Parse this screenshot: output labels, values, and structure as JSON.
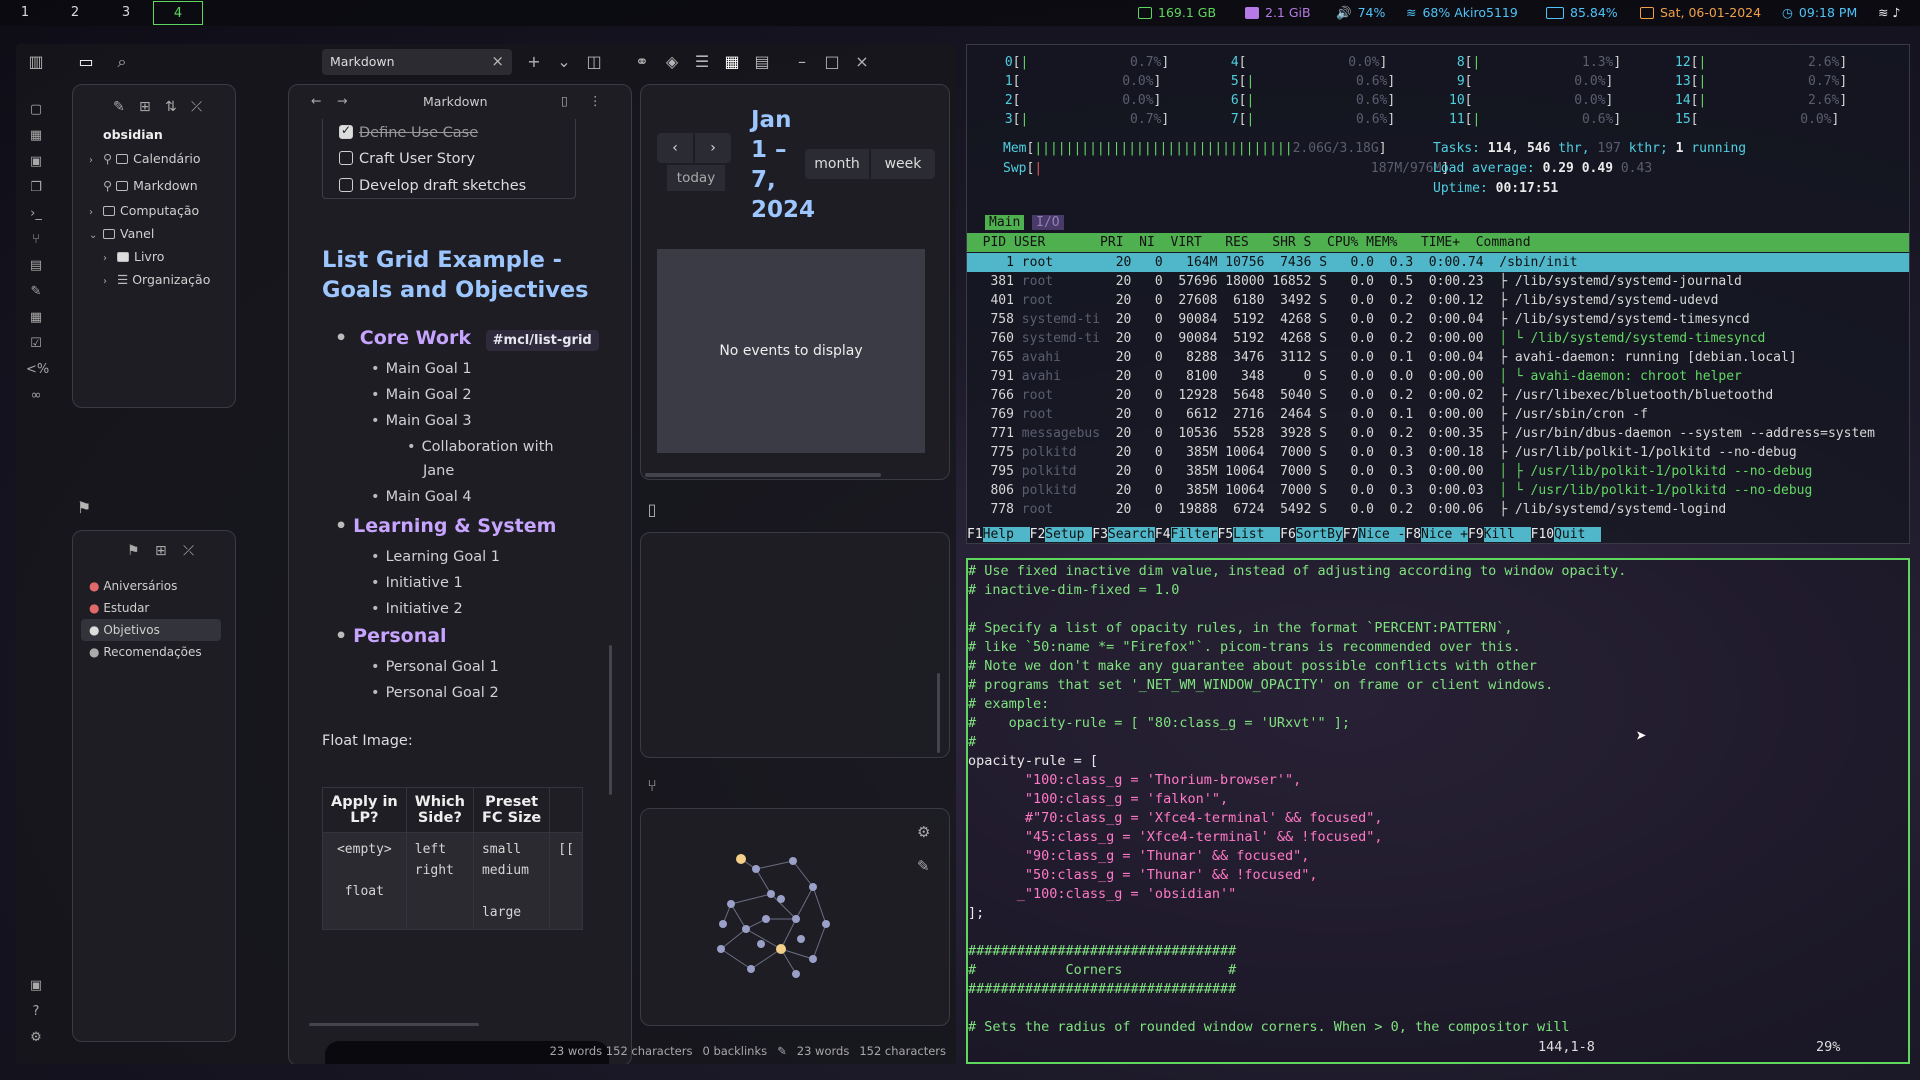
{
  "topbar": {
    "workspaces": [
      "1",
      "2",
      "3",
      "4"
    ],
    "active_workspace": "4",
    "disk": "169.1 GB",
    "memory": "2.1 GiB",
    "volume": "74%",
    "wifi": "68% Akiro5119",
    "battery": "85.84%",
    "date": "Sat, 06-01-2024",
    "time": "09:18 PM"
  },
  "obsidian": {
    "tab_title": "Markdown",
    "vault_name": "obsidian",
    "file_tree": [
      {
        "label": "Calendário",
        "type": "pinned"
      },
      {
        "label": "Markdown",
        "type": "pinned"
      },
      {
        "label": "Computação",
        "type": "folder"
      },
      {
        "label": "Vanel",
        "type": "folder-open"
      },
      {
        "label": "Livro",
        "type": "subfolder"
      },
      {
        "label": "Organização",
        "type": "subfolder"
      }
    ],
    "bookmarks": [
      "Aniversários",
      "Estudar",
      "Objetivos",
      "Recomendações"
    ],
    "selected_bookmark": "Objetivos",
    "editor": {
      "header_title": "Markdown",
      "checklist": [
        {
          "label": "Define Use Case",
          "checked": true
        },
        {
          "label": "Craft User Story",
          "checked": false
        },
        {
          "label": "Develop draft sketches",
          "checked": false
        }
      ],
      "heading_line1": "List Grid Example -",
      "heading_line2": "Goals and Objectives",
      "core_work": "Core Work",
      "core_tag": "#mcl/list-grid",
      "goals": [
        "Main Goal 1",
        "Main Goal 2",
        "Main Goal 3"
      ],
      "collab_line1": "Collaboration with",
      "collab_line2": "Jane",
      "goal4": "Main Goal 4",
      "learning": "Learning & System",
      "learning_items": [
        "Learning Goal 1",
        "Initiative 1",
        "Initiative 2"
      ],
      "personal": "Personal",
      "personal_items": [
        "Personal Goal 1",
        "Personal Goal 2"
      ],
      "float_label": "Float Image:",
      "table": {
        "headers": [
          [
            "Apply in",
            "LP?"
          ],
          [
            "Which",
            "Side?"
          ],
          [
            "Preset",
            "FC Size"
          ]
        ],
        "col1": [
          "<empty>",
          "",
          "float"
        ],
        "col2": [
          "left",
          "right"
        ],
        "col3": [
          "small",
          "medium",
          "",
          "large"
        ],
        "col4": "[["
      }
    },
    "calendar": {
      "title_lines": [
        "Jan",
        "1 –",
        "7,",
        "2024"
      ],
      "today": "today",
      "month": "month",
      "week": "week",
      "no_events": "No events to display"
    },
    "status": {
      "left_counts": "23 words 152 characters",
      "backlinks": "0 backlinks",
      "words": "23 words",
      "chars": "152 characters"
    }
  },
  "htop": {
    "cpu_rows": [
      [
        "0",
        "0.7%",
        "4",
        "0.0%",
        "8",
        "1.3%",
        "12",
        "2.6%"
      ],
      [
        "1",
        "0.0%",
        "5",
        "0.6%",
        "9",
        "0.0%",
        "13",
        "0.7%"
      ],
      [
        "2",
        "0.0%",
        "6",
        "0.6%",
        "10",
        "0.0%",
        "14",
        "2.6%"
      ],
      [
        "3",
        "0.7%",
        "7",
        "0.6%",
        "11",
        "0.6%",
        "15",
        "0.0%"
      ]
    ],
    "mem": "2.06G/3.18G",
    "swp": "187M/976M",
    "tasks": "114",
    "threads": "546",
    "kthr": "197",
    "running": "1",
    "load": [
      "0.29",
      "0.49",
      "0.43"
    ],
    "uptime": "00:17:51",
    "tabs": [
      "Main",
      "I/O"
    ],
    "columns": "  PID USER       PRI  NI  VIRT   RES   SHR S  CPU% MEM%   TIME+  Command",
    "processes": [
      {
        "pid": "1",
        "user": "root",
        "virt": "164M",
        "res": "10756",
        "shr": "7436",
        "cpu": "0.0",
        "mem": "0.3",
        "time": "0:00.74",
        "cmd": "/sbin/init"
      },
      {
        "pid": "381",
        "user": "root",
        "virt": "57696",
        "res": "18000",
        "shr": "16852",
        "cpu": "0.0",
        "mem": "0.5",
        "time": "0:00.23",
        "cmd": "├ /lib/systemd/systemd-journald"
      },
      {
        "pid": "401",
        "user": "root",
        "virt": "27608",
        "res": "6180",
        "shr": "3492",
        "cpu": "0.0",
        "mem": "0.2",
        "time": "0:00.12",
        "cmd": "├ /lib/systemd/systemd-udevd"
      },
      {
        "pid": "758",
        "user": "systemd-ti",
        "virt": "90084",
        "res": "5192",
        "shr": "4268",
        "cpu": "0.0",
        "mem": "0.2",
        "time": "0:00.04",
        "cmd": "├ /lib/systemd/systemd-timesyncd"
      },
      {
        "pid": "760",
        "user": "systemd-ti",
        "virt": "90084",
        "res": "5192",
        "shr": "4268",
        "cpu": "0.0",
        "mem": "0.2",
        "time": "0:00.00",
        "cmd": "│ └ /lib/systemd/systemd-timesyncd"
      },
      {
        "pid": "765",
        "user": "avahi",
        "virt": "8288",
        "res": "3476",
        "shr": "3112",
        "cpu": "0.0",
        "mem": "0.1",
        "time": "0:00.04",
        "cmd": "├ avahi-daemon: running [debian.local]"
      },
      {
        "pid": "791",
        "user": "avahi",
        "virt": "8100",
        "res": "348",
        "shr": "0",
        "cpu": "0.0",
        "mem": "0.0",
        "time": "0:00.00",
        "cmd": "│ └ avahi-daemon: chroot helper"
      },
      {
        "pid": "766",
        "user": "root",
        "virt": "12928",
        "res": "5648",
        "shr": "5040",
        "cpu": "0.0",
        "mem": "0.2",
        "time": "0:00.02",
        "cmd": "├ /usr/libexec/bluetooth/bluetoothd"
      },
      {
        "pid": "769",
        "user": "root",
        "virt": "6612",
        "res": "2716",
        "shr": "2464",
        "cpu": "0.0",
        "mem": "0.1",
        "time": "0:00.00",
        "cmd": "├ /usr/sbin/cron -f"
      },
      {
        "pid": "771",
        "user": "messagebus",
        "virt": "10536",
        "res": "5528",
        "shr": "3928",
        "cpu": "0.0",
        "mem": "0.2",
        "time": "0:00.35",
        "cmd": "├ /usr/bin/dbus-daemon --system --address=system"
      },
      {
        "pid": "775",
        "user": "polkitd",
        "virt": "385M",
        "res": "10064",
        "shr": "7000",
        "cpu": "0.0",
        "mem": "0.3",
        "time": "0:00.18",
        "cmd": "├ /usr/lib/polkit-1/polkitd --no-debug"
      },
      {
        "pid": "795",
        "user": "polkitd",
        "virt": "385M",
        "res": "10064",
        "shr": "7000",
        "cpu": "0.0",
        "mem": "0.3",
        "time": "0:00.00",
        "cmd": "│ ├ /usr/lib/polkit-1/polkitd --no-debug"
      },
      {
        "pid": "806",
        "user": "polkitd",
        "virt": "385M",
        "res": "10064",
        "shr": "7000",
        "cpu": "0.0",
        "mem": "0.3",
        "time": "0:00.03",
        "cmd": "│ └ /usr/lib/polkit-1/polkitd --no-debug"
      },
      {
        "pid": "778",
        "user": "root",
        "virt": "19888",
        "res": "6724",
        "shr": "5492",
        "cpu": "0.0",
        "mem": "0.2",
        "time": "0:00.06",
        "cmd": "├ /lib/systemd/systemd-logind"
      }
    ],
    "fkeys": [
      [
        "F1",
        "Help"
      ],
      [
        "F2",
        "Setup"
      ],
      [
        "F3",
        "Search"
      ],
      [
        "F4",
        "Filter"
      ],
      [
        "F5",
        "List"
      ],
      [
        "F6",
        "SortBy"
      ],
      [
        "F7",
        "Nice -"
      ],
      [
        "F8",
        "Nice +"
      ],
      [
        "F9",
        "Kill"
      ],
      [
        "F10",
        "Quit"
      ]
    ]
  },
  "vim": {
    "lines": [
      {
        "t": "# Use fixed inactive dim value, instead of adjusting according to window opacity.",
        "c": "comment"
      },
      {
        "t": "# inactive-dim-fixed = 1.0",
        "c": "comment"
      },
      {
        "t": "",
        "c": "plain"
      },
      {
        "t": "# Specify a list of opacity rules, in the format `PERCENT:PATTERN`,",
        "c": "comment"
      },
      {
        "t": "# like `50:name *= \"Firefox\"`. picom-trans is recommended over this.",
        "c": "comment"
      },
      {
        "t": "# Note we don't make any guarantee about possible conflicts with other",
        "c": "comment"
      },
      {
        "t": "# programs that set '_NET_WM_WINDOW_OPACITY' on frame or client windows.",
        "c": "comment"
      },
      {
        "t": "# example:",
        "c": "comment"
      },
      {
        "t": "#    opacity-rule = [ \"80:class_g = 'URxvt'\" ];",
        "c": "comment"
      },
      {
        "t": "#",
        "c": "comment"
      },
      {
        "t": "opacity-rule = [",
        "c": "plain"
      },
      {
        "t": "       \"100:class_g = 'Thorium-browser'\",",
        "c": "string"
      },
      {
        "t": "       \"100:class_g = 'falkon'\",",
        "c": "string"
      },
      {
        "t": "       #\"70:class_g = 'Xfce4-terminal' && focused\",",
        "c": "string"
      },
      {
        "t": "       \"45:class_g = 'Xfce4-terminal' && !focused\",",
        "c": "string"
      },
      {
        "t": "       \"90:class_g = 'Thunar' && focused\",",
        "c": "string"
      },
      {
        "t": "       \"50:class_g = 'Thunar' && !focused\",",
        "c": "string"
      },
      {
        "t": "      _\"100:class_g = 'obsidian'\"",
        "c": "string"
      },
      {
        "t": "];",
        "c": "plain"
      },
      {
        "t": "",
        "c": "plain"
      },
      {
        "t": "#################################",
        "c": "comment"
      },
      {
        "t": "#           Corners             #",
        "c": "comment"
      },
      {
        "t": "#################################",
        "c": "comment"
      },
      {
        "t": "",
        "c": "plain"
      },
      {
        "t": "# Sets the radius of rounded window corners. When > 0, the compositor will",
        "c": "comment"
      }
    ],
    "position": "144,1-8",
    "percent": "29%"
  }
}
